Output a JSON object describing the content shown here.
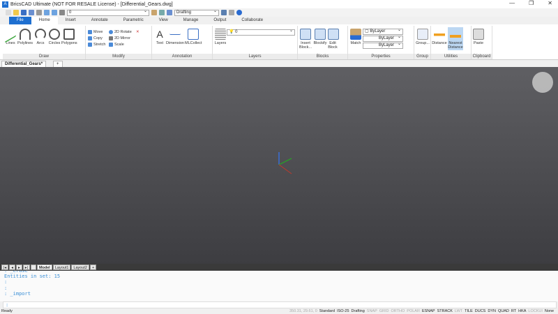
{
  "title": "BricsCAD Ultimate (NOT FOR RESALE License) - [Differential_Gears.dwg]",
  "qat": {
    "layer_combo": "0",
    "workspace": "Drafting"
  },
  "tabs": [
    "File",
    "Home",
    "Insert",
    "Annotate",
    "Parametric",
    "View",
    "Manage",
    "Output",
    "Collaborate"
  ],
  "ribbon": {
    "draw": {
      "title": "Draw",
      "items": [
        "Lines",
        "Polylines",
        "Arcs",
        "Circles",
        "Polygons"
      ]
    },
    "modify": {
      "title": "Modify",
      "items": [
        "Move",
        "Copy",
        "Stretch",
        "2D Rotate",
        "2D Mirror",
        "Scale"
      ]
    },
    "annotation": {
      "title": "Annotation",
      "items": [
        "Text",
        "Dimension",
        "MLCollect"
      ]
    },
    "layers": {
      "title": "Layers",
      "button": "Layers",
      "layer_combo": "0"
    },
    "blocks": {
      "title": "Blocks",
      "items": [
        "Insert Block...",
        "Blockify",
        "Edit Block"
      ]
    },
    "properties": {
      "title": "Properties",
      "match": "Match",
      "color": "ByLayer",
      "linetype": "ByLayer",
      "lineweight": "ByLayer"
    },
    "group": {
      "title": "Group",
      "items": [
        "Group..."
      ]
    },
    "utilities": {
      "title": "Utilities",
      "items": [
        "Distance",
        "Nearest Distance"
      ]
    },
    "clipboard": {
      "title": "Clipboard",
      "items": [
        "Paste"
      ]
    }
  },
  "document_tab": "Differential_Gears*",
  "layout_tabs": [
    "Model",
    "Layout1",
    "Layout2",
    "+"
  ],
  "command_history": [
    ": _erase",
    "Entities in set: 15",
    ":",
    ":",
    ": _import"
  ],
  "command_prompt": ":",
  "status": {
    "ready": "Ready",
    "coords": "350.31, 29.61, 0",
    "toggles": [
      {
        "label": "Standard",
        "on": true
      },
      {
        "label": "ISO-25",
        "on": true
      },
      {
        "label": "Drafting",
        "on": true
      },
      {
        "label": "SNAP",
        "on": false
      },
      {
        "label": "GRID",
        "on": false
      },
      {
        "label": "ORTHO",
        "on": false
      },
      {
        "label": "POLAR",
        "on": false
      },
      {
        "label": "ESNAP",
        "on": true
      },
      {
        "label": "STRACK",
        "on": true
      },
      {
        "label": "LWT",
        "on": false
      },
      {
        "label": "TILE",
        "on": true
      },
      {
        "label": "DUCS",
        "on": true
      },
      {
        "label": "DYN",
        "on": true
      },
      {
        "label": "QUAD",
        "on": true
      },
      {
        "label": "RT",
        "on": true
      },
      {
        "label": "HKA",
        "on": true
      },
      {
        "label": "LOCKUI",
        "on": false
      },
      {
        "label": "None",
        "on": true
      }
    ]
  }
}
